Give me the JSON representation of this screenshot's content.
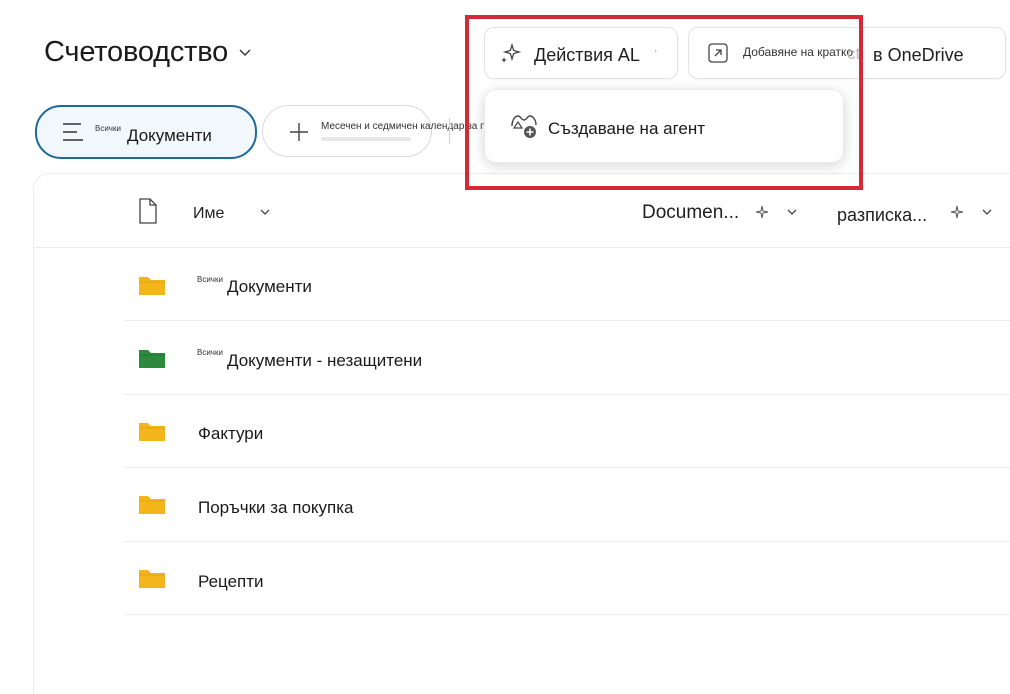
{
  "library": {
    "title": "Счетоводство"
  },
  "toolbar": {
    "ai_label": "Действия AL",
    "shortcut_small": "Добавяне на кратко",
    "shortcut_ghost": "ct",
    "shortcut_label": "в OneDrive"
  },
  "views": {
    "active_prefix": "Всички",
    "active_label": "Документи",
    "add_label": "Месечен и седмичен календар за планиране (Wor"
  },
  "menu": {
    "items": [
      {
        "label": "Създаване на агент",
        "icon": "create-agent-icon"
      }
    ]
  },
  "columns": {
    "name": "Име",
    "document": "Documen...",
    "receipt": "разписка..."
  },
  "rows": [
    {
      "prefix": "Всички",
      "name": "Документи",
      "folder_color": "#f3b51a"
    },
    {
      "prefix": "Всички",
      "name": "Документи - незащитени",
      "folder_color": "#2b8a3e"
    },
    {
      "prefix": "",
      "name": "Фактури",
      "folder_color": "#f3b51a"
    },
    {
      "prefix": "",
      "name": "Поръчки за покупка",
      "folder_color": "#f3b51a"
    },
    {
      "prefix": "",
      "name": "Рецепти",
      "folder_color": "#f3b51a"
    }
  ],
  "colors": {
    "accent": "#1e6a98",
    "highlight": "#d42a35"
  }
}
